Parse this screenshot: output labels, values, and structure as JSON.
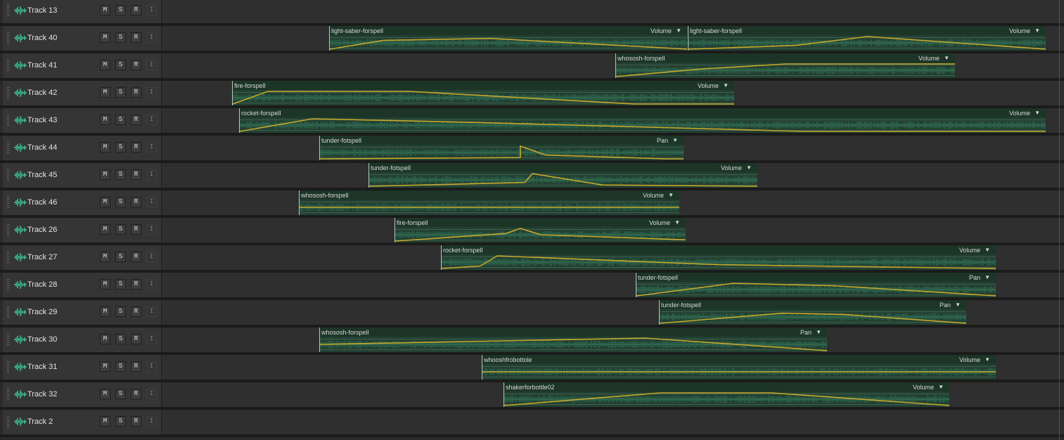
{
  "tracks": [
    {
      "name": "Track 13",
      "buttons": [
        "M",
        "S",
        "R",
        "I"
      ],
      "clips": []
    },
    {
      "name": "Track 40",
      "buttons": [
        "M",
        "S",
        "R",
        "I"
      ],
      "clips": [
        {
          "name": "light-saber-forspell",
          "param": "Volume"
        },
        {
          "name": "light-saber-forspell",
          "param": "Volume"
        }
      ]
    },
    {
      "name": "Track 41",
      "buttons": [
        "M",
        "S",
        "R",
        "I"
      ],
      "clips": [
        {
          "name": "whososh-forspell",
          "param": "Volume"
        }
      ]
    },
    {
      "name": "Track 42",
      "buttons": [
        "M",
        "S",
        "R",
        "I"
      ],
      "clips": [
        {
          "name": "fire-forspell",
          "param": "Volume"
        }
      ]
    },
    {
      "name": "Track 43",
      "buttons": [
        "M",
        "S",
        "R",
        "I"
      ],
      "clips": [
        {
          "name": "rocket-forspell",
          "param": "Volume"
        }
      ]
    },
    {
      "name": "Track 44",
      "buttons": [
        "M",
        "S",
        "R",
        "I"
      ],
      "clips": [
        {
          "name": "tunder-fotspell",
          "param": "Pan"
        }
      ]
    },
    {
      "name": "Track 45",
      "buttons": [
        "M",
        "S",
        "R",
        "I"
      ],
      "clips": [
        {
          "name": "tunder-fotspell",
          "param": "Volume"
        }
      ]
    },
    {
      "name": "Track 46",
      "buttons": [
        "M",
        "S",
        "R",
        "I"
      ],
      "clips": [
        {
          "name": "whososh-forspell",
          "param": "Volume"
        }
      ]
    },
    {
      "name": "Track 26",
      "buttons": [
        "M",
        "S",
        "R",
        "I"
      ],
      "clips": [
        {
          "name": "fire-forspell",
          "param": "Volume"
        }
      ]
    },
    {
      "name": "Track 27",
      "buttons": [
        "M",
        "S",
        "R",
        "I"
      ],
      "clips": [
        {
          "name": "rocket-forspell",
          "param": "Volume"
        }
      ]
    },
    {
      "name": "Track 28",
      "buttons": [
        "M",
        "S",
        "R",
        "I"
      ],
      "clips": [
        {
          "name": "tunder-fotspell",
          "param": "Pan"
        }
      ]
    },
    {
      "name": "Track 29",
      "buttons": [
        "M",
        "S",
        "R",
        "I"
      ],
      "clips": [
        {
          "name": "tunder-fotspell",
          "param": "Pan"
        }
      ]
    },
    {
      "name": "Track 30",
      "buttons": [
        "M",
        "S",
        "R",
        "I"
      ],
      "clips": [
        {
          "name": "whososh-forspell",
          "param": "Pan"
        }
      ]
    },
    {
      "name": "Track 31",
      "buttons": [
        "M",
        "S",
        "R",
        "I"
      ],
      "clips": [
        {
          "name": "whooshfrobottole",
          "param": "Volume"
        }
      ]
    },
    {
      "name": "Track 32",
      "buttons": [
        "M",
        "S",
        "R",
        "I"
      ],
      "clips": [
        {
          "name": "shakerforbottle02",
          "param": "Volume"
        }
      ]
    },
    {
      "name": "Track 2",
      "buttons": [
        "M",
        "S",
        "R",
        "I"
      ],
      "clips": []
    }
  ],
  "dropdown_glyph": "▼",
  "colors": {
    "accent_wave": "#3fd09a",
    "envelope": "#c9a82a",
    "clip_body": "#234032",
    "playhead": "#b42424"
  }
}
